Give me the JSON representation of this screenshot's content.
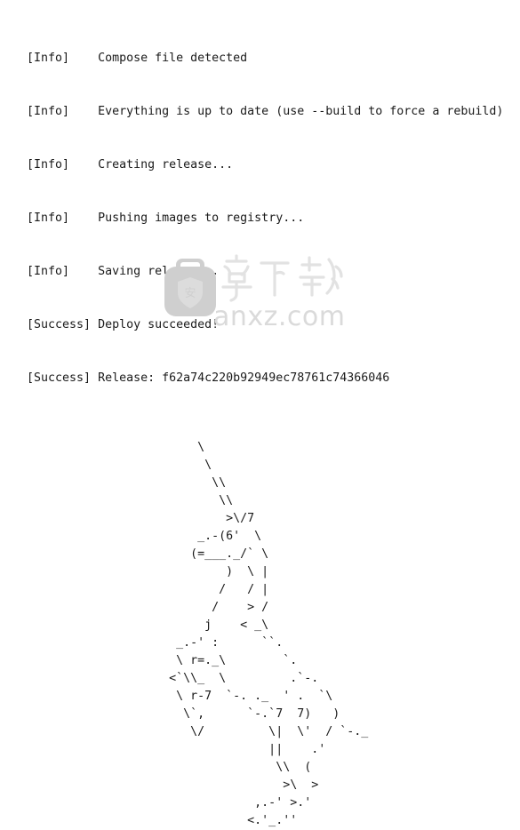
{
  "console": {
    "log_lines": [
      {
        "tag": "[Info]    ",
        "message": "Compose file detected"
      },
      {
        "tag": "[Info]    ",
        "message": "Everything is up to date (use --build to force a rebuild)"
      },
      {
        "tag": "[Info]    ",
        "message": "Creating release..."
      },
      {
        "tag": "[Info]    ",
        "message": "Pushing images to registry..."
      },
      {
        "tag": "[Info]    ",
        "message": "Saving release..."
      },
      {
        "tag": "[Success] ",
        "message": "Deploy succeeded!"
      },
      {
        "tag": "[Success] ",
        "message": "Release: f62a74c220b92949ec78761c74366046"
      }
    ],
    "release_id": "f62a74c220b92949ec78761c74366046",
    "text_color": "#1a1a1a",
    "background_color": "#ffffff"
  },
  "ascii_art": {
    "name": "whale-ascii-art",
    "body": "                        \\\n                         \\\n                          \\\\\n                           \\\\\n                            >\\/7\n                        _.-(6'  \\\n                       (=___._/` \\\n                            )  \\ |\n                           /   / |\n                          /    > /\n                         j    < _\\\n                     _.-' :      ``.\n                     \\ r=._\\        `.\n                    <`\\\\_  \\         .`-.\n                     \\ r-7  `-. ._  ' .  `\\\n                      \\`,      `-.`7  7)   )\n                       \\/         \\|  \\'  / `-._\n                                  ||    .'\n                                   \\\\  (\n                                    >\\  >\n                                ,.-' >.'\n                               <.'_.''"
  },
  "watermark": {
    "site_text": "anxz.com",
    "brand_chars": "安下载",
    "shield_char": "安",
    "icon_name": "briefcase-shield-icon",
    "color": "#cfcfcf",
    "text_color": "#d8d8d8"
  }
}
